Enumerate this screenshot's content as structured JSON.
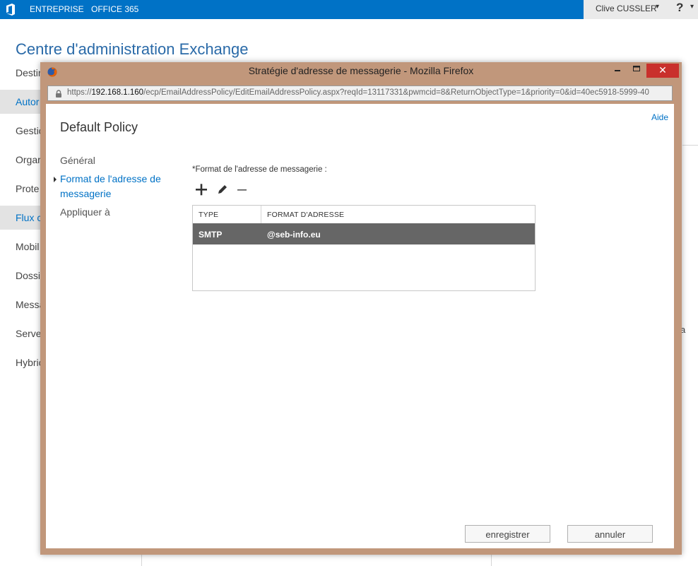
{
  "topbar": {
    "nav": [
      "ENTREPRISE",
      "OFFICE 365"
    ],
    "user_name": "Clive CUSSLER",
    "help_glyph": "?",
    "caret_glyph": "▾",
    "icons": [
      "office-logo-icon",
      "chevron-down-icon",
      "help-icon"
    ]
  },
  "admin": {
    "title": "Centre d'administration Exchange",
    "nav_items": [
      {
        "label": "Destir",
        "selected": false
      },
      {
        "label": "Autor",
        "selected": true
      },
      {
        "label": "Gestic",
        "selected": false
      },
      {
        "label": "Orgar",
        "selected": false
      },
      {
        "label": "Prote",
        "selected": false
      },
      {
        "label": "Flux c",
        "selected": true
      },
      {
        "label": "Mobil",
        "selected": false
      },
      {
        "label": "Dossi",
        "selected": false
      },
      {
        "label": "Messa",
        "selected": false
      },
      {
        "label": "Serve",
        "selected": false
      },
      {
        "label": "Hybric",
        "selected": false
      }
    ],
    "stray_char": "a"
  },
  "firefox": {
    "title": "Stratégie d'adresse de messagerie - Mozilla Firefox",
    "controls": {
      "minimize": "–",
      "maximize": "□",
      "close": "✕"
    },
    "url": {
      "scheme": "https://",
      "host": "192.168.1.160",
      "path": "/ecp/EmailAddressPolicy/EditEmailAddressPolicy.aspx?reqId=13117331&pwmcid=8&ReturnObjectType=1&priority=0&id=40ec5918-5999-40"
    },
    "icons": [
      "firefox-icon",
      "lock-icon"
    ]
  },
  "dialog": {
    "help_link": "Aide",
    "policy_name": "Default Policy",
    "menu": [
      {
        "label": "Général",
        "active": false
      },
      {
        "label": "Format de l'adresse de messagerie",
        "active": true
      },
      {
        "label": "Appliquer à",
        "active": false
      }
    ],
    "field_label": "*Format de l'adresse de messagerie :",
    "toolbar": {
      "add": "add-icon",
      "edit": "edit-icon",
      "remove": "remove-icon"
    },
    "table": {
      "columns": [
        "TYPE",
        "FORMAT D'ADRESSE"
      ],
      "rows": [
        {
          "type": "SMTP",
          "format": "@seb-info.eu",
          "selected": true
        }
      ]
    },
    "buttons": {
      "save": "enregistrer",
      "cancel": "annuler"
    }
  },
  "colors": {
    "exchange_blue": "#0072c6",
    "window_frame": "#c1977b",
    "close_red": "#c9302c",
    "selected_row": "#666666"
  }
}
